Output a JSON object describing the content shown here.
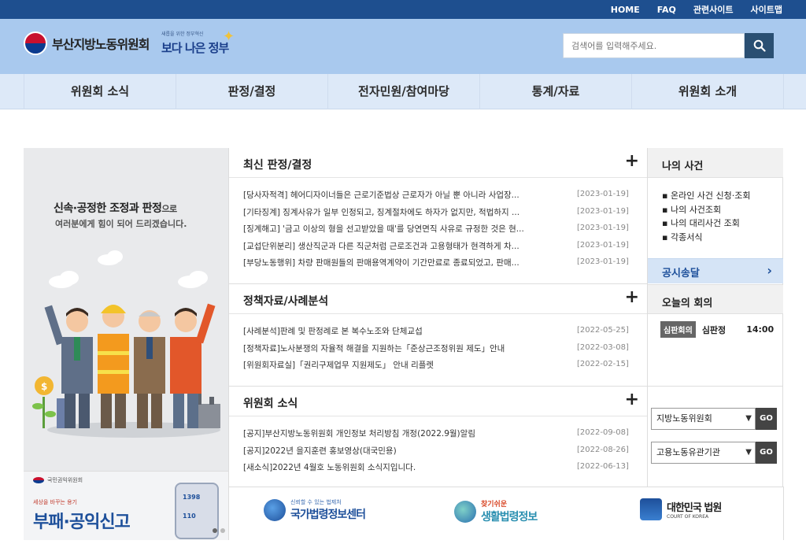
{
  "utility_links": [
    "HOME",
    "FAQ",
    "관련사이트",
    "사이트맵"
  ],
  "header": {
    "org_name": "부산지방노동위원회",
    "gov_slogan_small": "새롭을 위한 정부혁신",
    "gov_slogan": "보다 나은 정부"
  },
  "search": {
    "placeholder": "검색어를 입력해주세요."
  },
  "nav": [
    "위원회 소식",
    "판정/결정",
    "전자민원/참여마당",
    "통계/자료",
    "위원회 소개"
  ],
  "banner": {
    "slogan_bold": "신속·공정한 조정과 판정",
    "slogan_suffix": "으로",
    "slogan_line2": "여러분에게 힘이 되어 드리겠습니다."
  },
  "bottom_banner": {
    "agency": "국민권익위원회",
    "subtitle": "세상을 바꾸는 용기",
    "title": "부패·공익신고",
    "phone1": "1398",
    "phone2": "110"
  },
  "latest_decisions": {
    "title": "최신 판정/결정",
    "items": [
      {
        "text": "[당사자적격] 헤어디자이너들은 근로기준법상 근로자가 아닐 뿐 아니라 사업장...",
        "date": "[2023-01-19]"
      },
      {
        "text": "[기타징계] 징계사유가 일부 인정되고, 징계절차에도 하자가 없지만, 적법하지 ...",
        "date": "[2023-01-19]"
      },
      {
        "text": "[징계해고] '금고 이상의 형을 선고받았을 때'를 당연면직 사유로 규정한 것은 현...",
        "date": "[2023-01-19]"
      },
      {
        "text": "[교섭단위분리] 생산직군과 다른 직군처럼 근로조건과 고용형태가 현격하게 차...",
        "date": "[2023-01-19]"
      },
      {
        "text": "[부당노동행위] 차량 판매원들의 판매용역계약이 기간만료로 종료되었고, 판매...",
        "date": "[2023-01-19]"
      }
    ]
  },
  "policy_materials": {
    "title": "정책자료/사례분석",
    "items": [
      {
        "text": "[사례분석]판례 및 판정례로 본 복수노조와 단체교섭",
        "date": "[2022-05-25]"
      },
      {
        "text": "[정책자료]노사분쟁의 자율적 해결을 지원하는「준상근조정위원 제도」안내",
        "date": "[2022-03-08]"
      },
      {
        "text": "[위원회자료실]「권리구제업무 지원제도」 안내 리플렛",
        "date": "[2022-02-15]"
      }
    ]
  },
  "committee_news": {
    "title": "위원회 소식",
    "items": [
      {
        "text": "[공지]부산지방노동위원회 개인정보 처리방침 개정(2022.9월)알림",
        "date": "[2022-09-08]"
      },
      {
        "text": "[공지]2022년 을지훈련 홍보영상(대국민용)",
        "date": "[2022-08-26]"
      },
      {
        "text": "[새소식]2022년 4월호 노동위원회 소식지입니다.",
        "date": "[2022-06-13]"
      }
    ]
  },
  "my_case": {
    "title": "나의 사건",
    "items": [
      "온라인 사건 신청·조회",
      "나의 사건조회",
      "나의 대리사건 조회",
      "각종서식"
    ]
  },
  "notice_delivery": "공시송달",
  "today_meeting": {
    "title": "오늘의 회의",
    "badge": "심판회의",
    "kind": "심판정",
    "time": "14:00"
  },
  "selects": [
    {
      "value": "지방노동위원회",
      "go": "GO"
    },
    {
      "value": "고용노동유관기관",
      "go": "GO"
    }
  ],
  "partners": [
    {
      "small": "신뢰할 수 있는 법제처",
      "name": "국가법령정보센터"
    },
    {
      "small": "찾기쉬운",
      "name": "생활법령정보"
    },
    {
      "small": "",
      "name": "대한민국 법원",
      "sub": "COURT OF KOREA"
    }
  ],
  "colors": {
    "topbar": "#1e4f8f",
    "header": "#a9c9ee",
    "nav": "#dde9f8",
    "accent": "#1d4f9a"
  }
}
